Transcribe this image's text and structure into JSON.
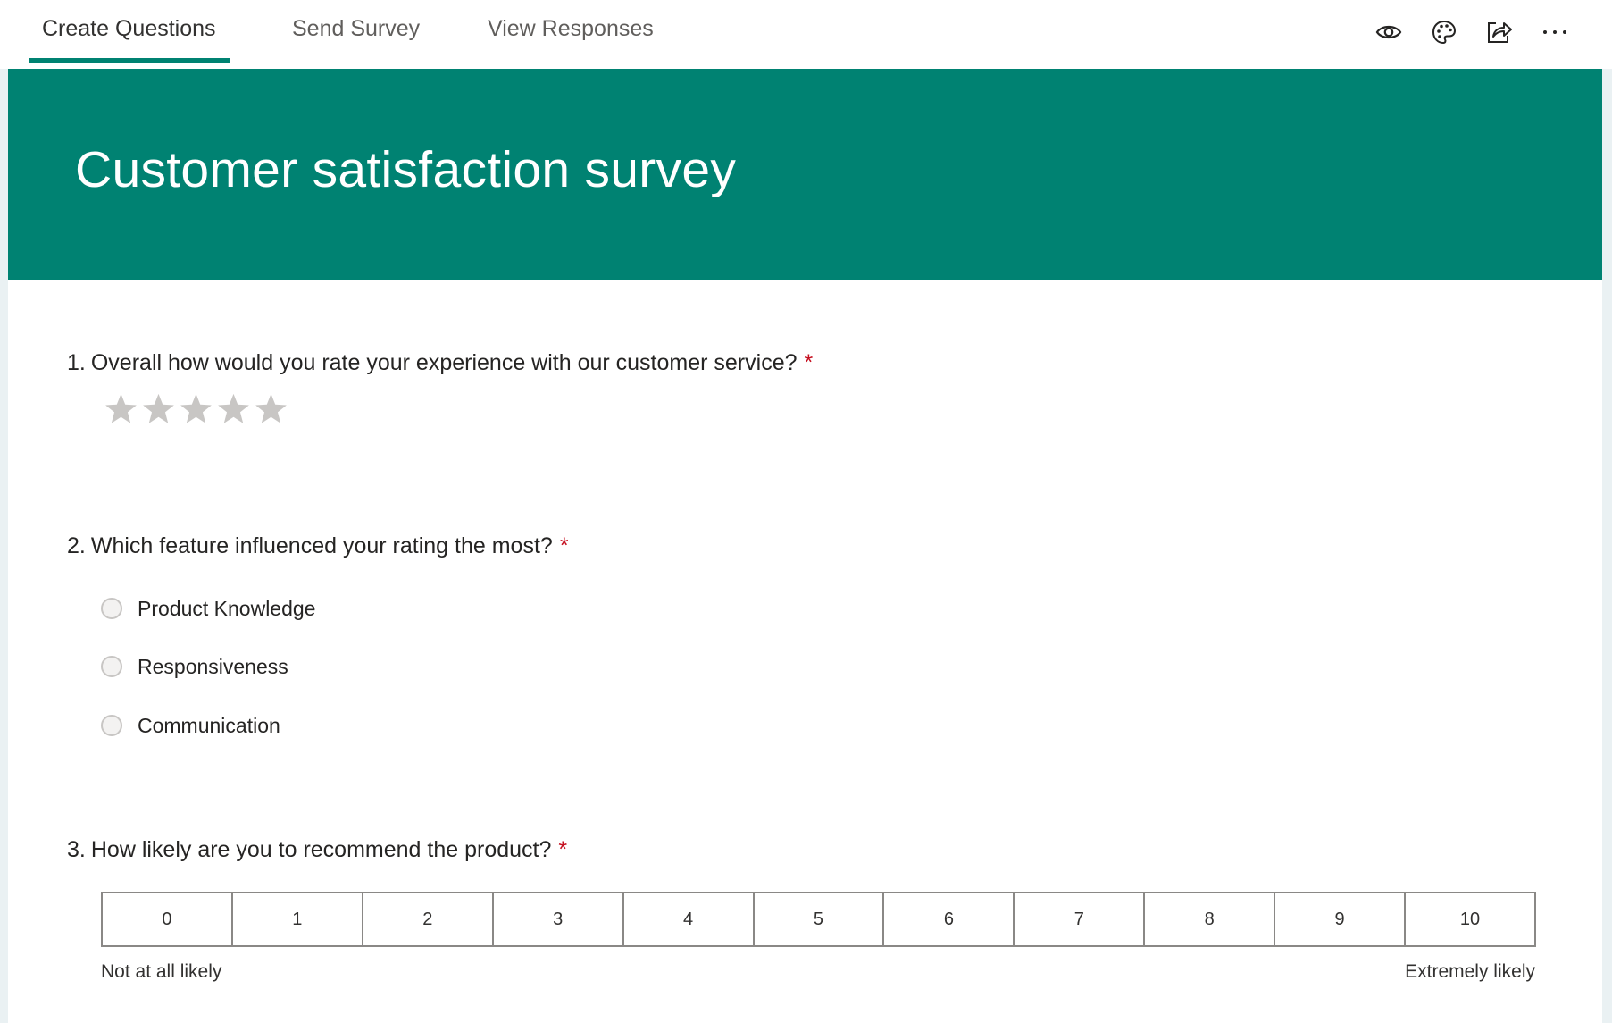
{
  "tabs": [
    {
      "label": "Create Questions",
      "active": true
    },
    {
      "label": "Send Survey",
      "active": false
    },
    {
      "label": "View Responses",
      "active": false
    }
  ],
  "toolbar": {
    "icons": [
      "eye-icon",
      "palette-icon",
      "share-icon",
      "more-icon"
    ]
  },
  "colors": {
    "accent": "#008272",
    "required": "#c50f1f",
    "star_empty": "#c8c6c4"
  },
  "form": {
    "title": "Customer satisfaction survey"
  },
  "questions": [
    {
      "number": "1.",
      "text": "Overall how would you rate your experience with our customer service?",
      "required_mark": "*",
      "type": "rating",
      "stars": 5,
      "selected": 0
    },
    {
      "number": "2.",
      "text": "Which feature influenced your rating the most?",
      "required_mark": "*",
      "type": "choice",
      "options": [
        "Product Knowledge",
        "Responsiveness",
        "Communication"
      ]
    },
    {
      "number": "3.",
      "text": "How likely are you to recommend the product?",
      "required_mark": "*",
      "type": "nps",
      "scale": [
        "0",
        "1",
        "2",
        "3",
        "4",
        "5",
        "6",
        "7",
        "8",
        "9",
        "10"
      ],
      "low_label": "Not at all likely",
      "high_label": "Extremely likely"
    }
  ]
}
